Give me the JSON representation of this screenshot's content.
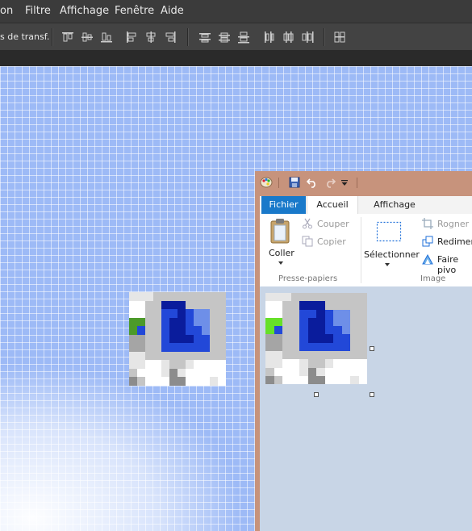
{
  "photoshop": {
    "menu": [
      "on",
      "Filtre",
      "Affichage",
      "Fenêtre",
      "Aide"
    ],
    "options_label": "s de transf."
  },
  "paint": {
    "tabs": {
      "file": "Fichier",
      "home": "Accueil",
      "view": "Affichage"
    },
    "clipboard": {
      "paste": "Coller",
      "cut": "Couper",
      "copy": "Copier",
      "group": "Presse-papiers"
    },
    "image": {
      "select": "Sélectionner",
      "crop": "Rogner",
      "resize": "Redimens",
      "rotate": "Faire pivo",
      "group": "Image"
    }
  },
  "colors": {
    "ps_bg": "#3b3b3b",
    "canvas_blue": "#9dbaf6",
    "paint_titlebar": "#c7937c",
    "file_tab": "#1979ca",
    "workspace": "#c8d5e6"
  },
  "icon_pixels": [
    "LLLMMMMMMMMM",
    "WWMMNNNMMMMM",
    "WWMMBBNBCCMM",
    "GGMMBNNBCCMM",
    "GBMMBNNBBCMM",
    "SSMMBNNNBBMM",
    "SSMMBBBBBBMM",
    "LLMMMMMMMMMM",
    "LLWWLMMLWWWW",
    "MWWWLDLWWWWW",
    "DMWWWDDWWWLW"
  ]
}
